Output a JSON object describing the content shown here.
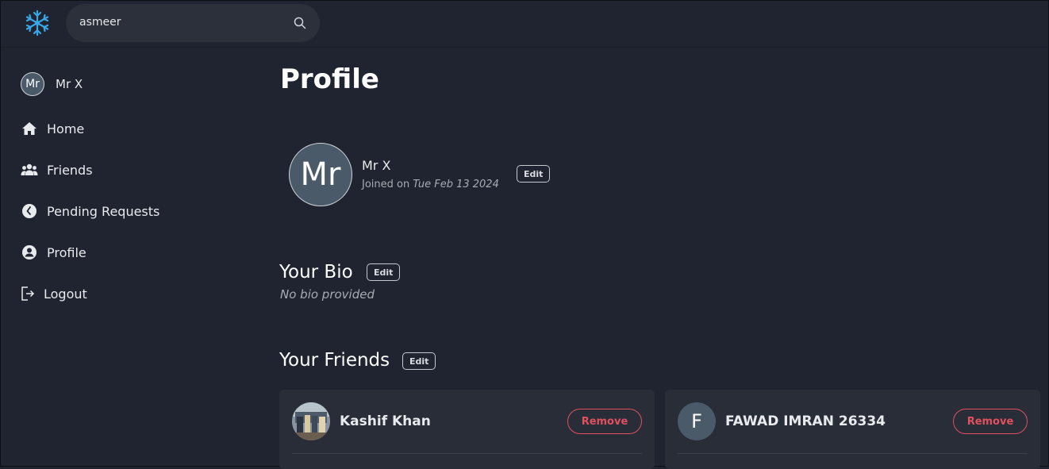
{
  "search": {
    "value": "asmeer",
    "icon": "search-icon"
  },
  "sidebar": {
    "user": {
      "initials": "Mr",
      "name": "Mr X"
    },
    "items": [
      {
        "label": "Home",
        "icon": "home-icon"
      },
      {
        "label": "Friends",
        "icon": "friends-icon"
      },
      {
        "label": "Pending Requests",
        "icon": "clock-icon"
      },
      {
        "label": "Profile",
        "icon": "user-circle-icon"
      },
      {
        "label": "Logout",
        "icon": "logout-icon"
      }
    ]
  },
  "profile": {
    "title": "Profile",
    "initials": "Mr",
    "name": "Mr X",
    "joined_prefix": "Joined on",
    "joined_date": "Tue Feb 13 2024",
    "edit_label": "Edit"
  },
  "bio": {
    "title": "Your Bio",
    "edit_label": "Edit",
    "text": "No bio provided"
  },
  "friends": {
    "title": "Your Friends",
    "edit_label": "Edit",
    "list": [
      {
        "name": "Kashif Khan",
        "initial": "",
        "has_photo": true,
        "remove_label": "Remove"
      },
      {
        "name": "FAWAD IMRAN 26334",
        "initial": "F",
        "has_photo": false,
        "remove_label": "Remove"
      }
    ]
  },
  "colors": {
    "background": "#1f2430",
    "card": "#282d38",
    "danger": "#e0505e",
    "accent": "#3aa6e6"
  }
}
